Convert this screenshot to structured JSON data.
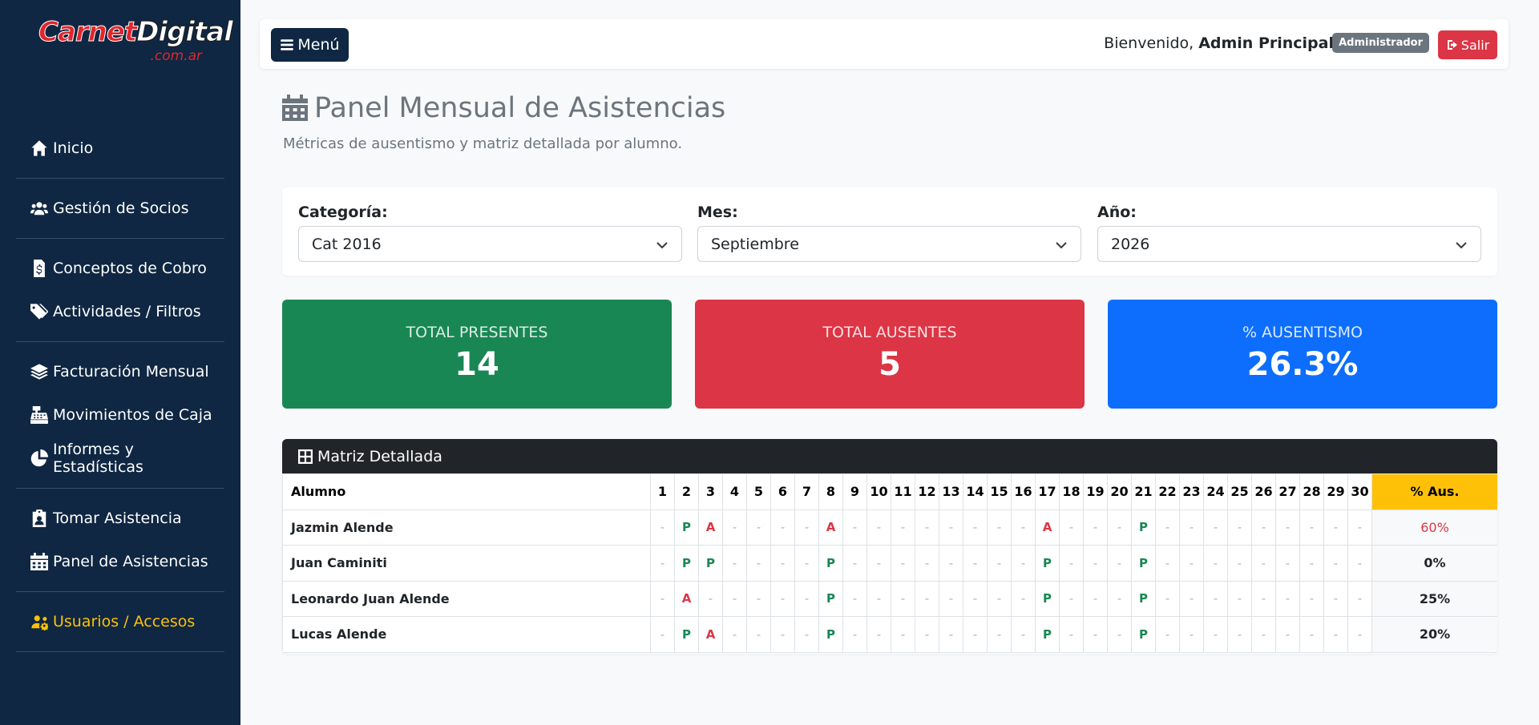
{
  "brand": {
    "name_part1": "Carnet",
    "name_part2": "Digital",
    "domain": ".com.ar"
  },
  "sidebar": {
    "groups": [
      [
        {
          "label": "Inicio",
          "icon": "home-icon"
        }
      ],
      [
        {
          "label": "Gestión de Socios",
          "icon": "users-icon"
        }
      ],
      [
        {
          "label": "Conceptos de Cobro",
          "icon": "file-invoice-dollar-icon"
        },
        {
          "label": "Actividades / Filtros",
          "icon": "tags-icon"
        }
      ],
      [
        {
          "label": "Facturación Mensual",
          "icon": "layers-icon"
        },
        {
          "label": "Movimientos de Caja",
          "icon": "cash-register-icon"
        },
        {
          "label": "Informes y Estadísticas",
          "icon": "pie-chart-icon"
        }
      ],
      [
        {
          "label": "Tomar Asistencia",
          "icon": "clipboard-user-icon"
        },
        {
          "label": "Panel de Asistencias",
          "icon": "calendar-icon"
        }
      ],
      [
        {
          "label": "Usuarios / Accesos",
          "icon": "users-cog-icon",
          "accent": "#ffc107"
        }
      ]
    ]
  },
  "topbar": {
    "menu_label": "Menú",
    "welcome_text": "Bienvenido,",
    "user_name": "Admin Principal",
    "role_badge": "Administrador",
    "logout_label": "Salir"
  },
  "page": {
    "title": "Panel Mensual de Asistencias",
    "subtitle": "Métricas de ausentismo y matriz detallada por alumno."
  },
  "filters": {
    "category": {
      "label": "Categoría:",
      "value": "Cat 2016"
    },
    "month": {
      "label": "Mes:",
      "value": "Septiembre"
    },
    "year": {
      "label": "Año:",
      "value": "2026"
    }
  },
  "stats": {
    "present": {
      "label": "TOTAL PRESENTES",
      "value": "14",
      "color": "#198754"
    },
    "absent": {
      "label": "TOTAL AUSENTES",
      "value": "5",
      "color": "#dc3545"
    },
    "absenteeism": {
      "label": "% AUSENTISMO",
      "value": "26.3%",
      "color": "#0d6efd"
    }
  },
  "matrix": {
    "title": "Matriz Detallada",
    "name_header": "Alumno",
    "pct_header": "% Aus.",
    "days": [
      "1",
      "2",
      "3",
      "4",
      "5",
      "6",
      "7",
      "8",
      "9",
      "10",
      "11",
      "12",
      "13",
      "14",
      "15",
      "16",
      "17",
      "18",
      "19",
      "20",
      "21",
      "22",
      "23",
      "24",
      "25",
      "26",
      "27",
      "28",
      "29",
      "30"
    ],
    "rows": [
      {
        "name": "Jazmin Alende",
        "pct": "60%",
        "marks": [
          "-",
          "P",
          "A",
          "-",
          "-",
          "-",
          "-",
          "A",
          "-",
          "-",
          "-",
          "-",
          "-",
          "-",
          "-",
          "-",
          "A",
          "-",
          "-",
          "-",
          "P",
          "-",
          "-",
          "-",
          "-",
          "-",
          "-",
          "-",
          "-",
          "-"
        ]
      },
      {
        "name": "Juan Caminiti",
        "pct": "0%",
        "marks": [
          "-",
          "P",
          "P",
          "-",
          "-",
          "-",
          "-",
          "P",
          "-",
          "-",
          "-",
          "-",
          "-",
          "-",
          "-",
          "-",
          "P",
          "-",
          "-",
          "-",
          "P",
          "-",
          "-",
          "-",
          "-",
          "-",
          "-",
          "-",
          "-",
          "-"
        ]
      },
      {
        "name": "Leonardo Juan Alende",
        "pct": "25%",
        "marks": [
          "-",
          "A",
          "-",
          "-",
          "-",
          "-",
          "-",
          "P",
          "-",
          "-",
          "-",
          "-",
          "-",
          "-",
          "-",
          "-",
          "P",
          "-",
          "-",
          "-",
          "P",
          "-",
          "-",
          "-",
          "-",
          "-",
          "-",
          "-",
          "-",
          "-"
        ]
      },
      {
        "name": "Lucas Alende",
        "pct": "20%",
        "marks": [
          "-",
          "P",
          "A",
          "-",
          "-",
          "-",
          "-",
          "P",
          "-",
          "-",
          "-",
          "-",
          "-",
          "-",
          "-",
          "-",
          "P",
          "-",
          "-",
          "-",
          "P",
          "-",
          "-",
          "-",
          "-",
          "-",
          "-",
          "-",
          "-",
          "-"
        ]
      }
    ]
  }
}
